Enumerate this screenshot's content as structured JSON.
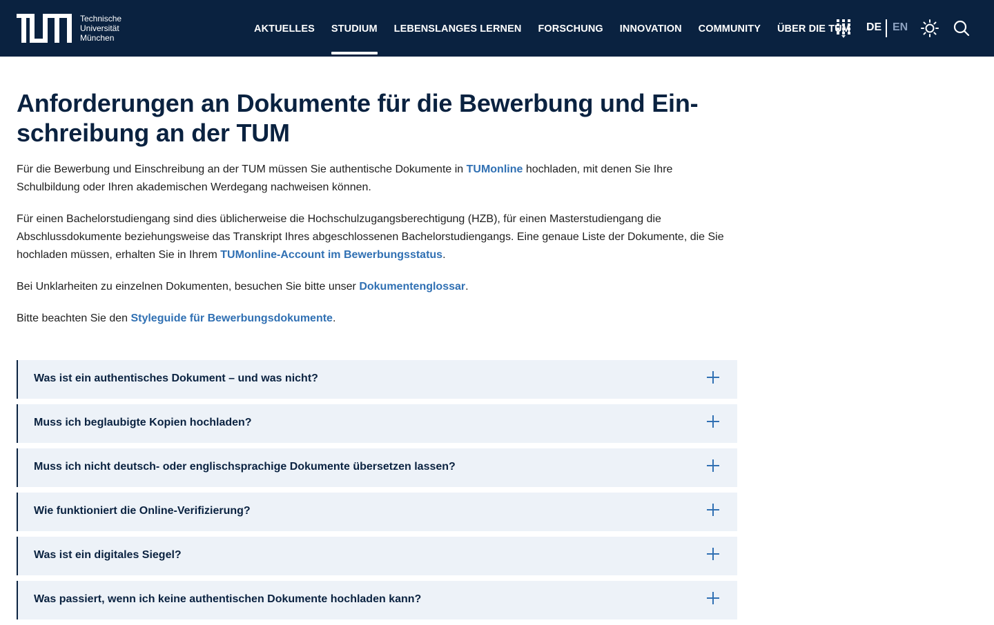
{
  "header": {
    "logo_alt": "TUM",
    "logo_lines": [
      "Technische",
      "Universität",
      "München"
    ],
    "nav": [
      {
        "label": "AKTUELLES",
        "active": false
      },
      {
        "label": "STUDIUM",
        "active": true
      },
      {
        "label": "LEBENSLANGES LERNEN",
        "active": false
      },
      {
        "label": "FORSCHUNG",
        "active": false
      },
      {
        "label": "INNOVATION",
        "active": false
      },
      {
        "label": "COMMUNITY",
        "active": false
      },
      {
        "label": "ÜBER DIE TUM",
        "active": false
      }
    ],
    "lang_active": "DE",
    "lang_other": "EN",
    "icons": {
      "apps": "apps-grid-icon",
      "theme": "sun-icon",
      "search": "search-icon"
    }
  },
  "main": {
    "title": "Anforderungen an Dokumente für die Bewerbung und Ein­schreibung an der TUM",
    "p1": {
      "before": "Für die Bewerbung und Einschreibung an der TUM müssen Sie authentische Dokumente in ",
      "link": "TUMonline",
      "after": " hochladen, mit denen Sie Ihre Schulbildung oder Ihren akademischen Werdegang nachweisen können."
    },
    "p2": {
      "before": "Für einen Bachelorstudiengang sind dies üblicherweise die Hochschulzugangsberechtigung (HZB), für einen Masterstudiengang die Abschlussdokumente beziehungsweise das Transkript Ihres abgeschlossenen Bachelorstudiengangs. Eine genaue Liste der Dokumente, die Sie hochladen müssen, erhalten Sie in Ihrem ",
      "link": "TUMonline-Account im Bewerbungsstatus",
      "after": "."
    },
    "p3": {
      "before": "Bei Unklarheiten zu einzelnen Dokumenten, besuchen Sie bitte unser ",
      "link": "Dokumentenglossar",
      "after": "."
    },
    "p4": {
      "before": "Bitte beachten Sie den ",
      "link": "Styleguide für Bewerbungsdokumente",
      "after": "."
    }
  },
  "faq": [
    "Was ist ein authentisches Dokument – und was nicht?",
    "Muss ich beglaubigte Kopien hochladen?",
    "Muss ich nicht deutsch- oder englischsprachige Dokumente übersetzen lassen?",
    "Wie funktioniert die Online-Verifizierung?",
    "Was ist ein digitales Siegel?",
    "Was passiert, wenn ich keine authentischen Dokumente hochladen kann?"
  ],
  "colors": {
    "navy": "#0a2240",
    "link": "#3070b3",
    "accordion_bg": "#edf2f8"
  }
}
